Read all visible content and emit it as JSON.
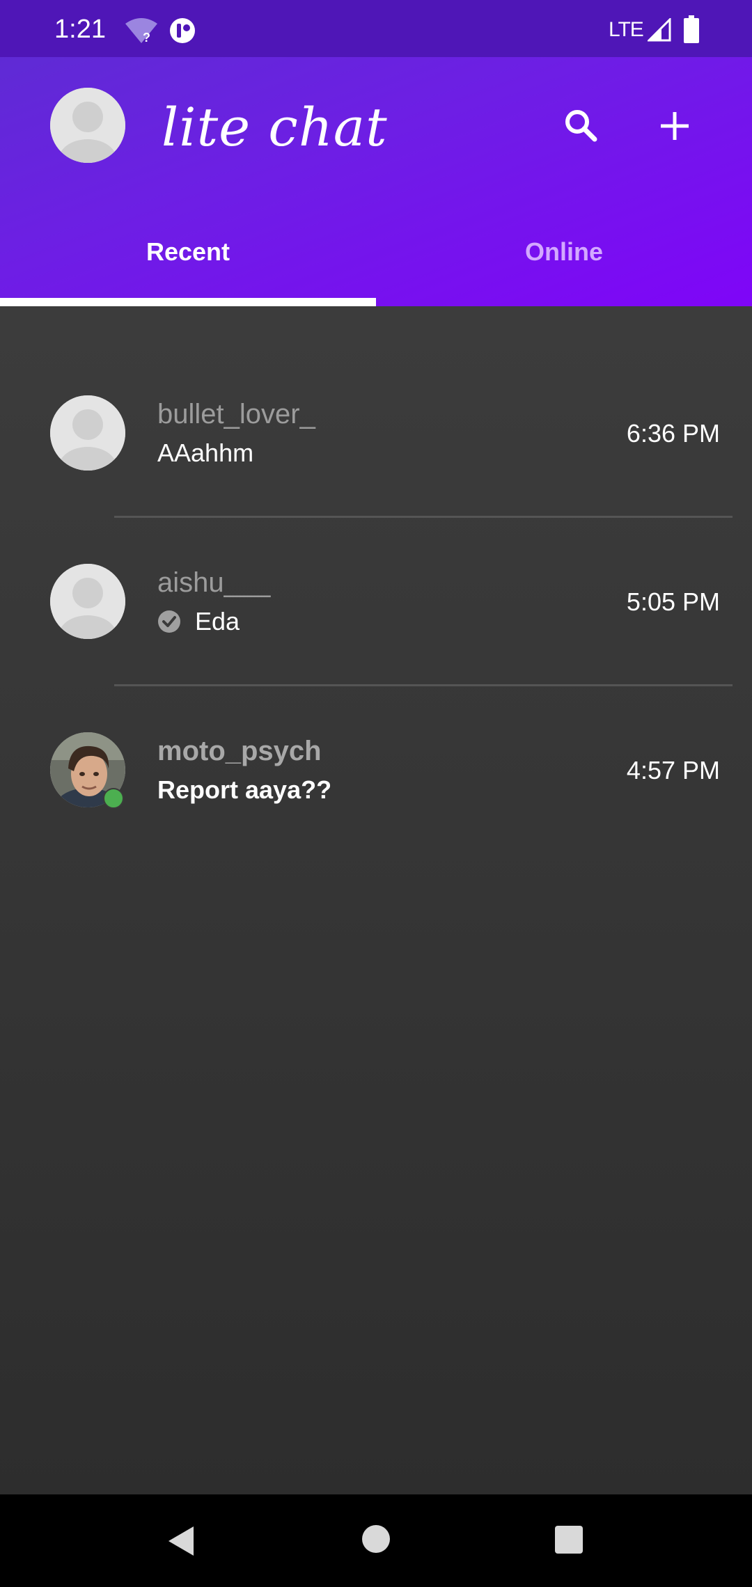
{
  "status_bar": {
    "time": "1:21",
    "network": "LTE",
    "icons": [
      "wifi-unknown-icon",
      "app-notification-icon",
      "signal-icon",
      "battery-icon"
    ]
  },
  "app_bar": {
    "title": "lite chat",
    "profile_icon": "avatar-placeholder-icon",
    "actions": [
      "search-icon",
      "add-icon"
    ],
    "gradient_colors": [
      "#5b2ed0",
      "#7f05f8"
    ]
  },
  "tabs": [
    {
      "label": "Recent",
      "selected": true
    },
    {
      "label": "Online",
      "selected": false
    }
  ],
  "chats": [
    {
      "name": "bullet_lover_",
      "message": "AAahhm",
      "time": "6:36 PM",
      "unread": false,
      "seen": false,
      "online": false,
      "avatar": "avatar-placeholder-icon"
    },
    {
      "name": "aishu___",
      "message": "Eda",
      "time": "5:05 PM",
      "unread": false,
      "seen": true,
      "online": false,
      "avatar": "avatar-placeholder-icon"
    },
    {
      "name": "moto_psych",
      "message": "Report aaya??",
      "time": "4:57 PM",
      "unread": true,
      "seen": false,
      "online": true,
      "avatar": "user-photo"
    }
  ],
  "nav_bar": {
    "icons": [
      "back-icon",
      "home-icon",
      "recents-icon"
    ]
  },
  "colors": {
    "accent": "#7f05f8",
    "online": "#4caf50",
    "background": "#2e2e2e",
    "tab_inactive": "#d3a8ff"
  }
}
